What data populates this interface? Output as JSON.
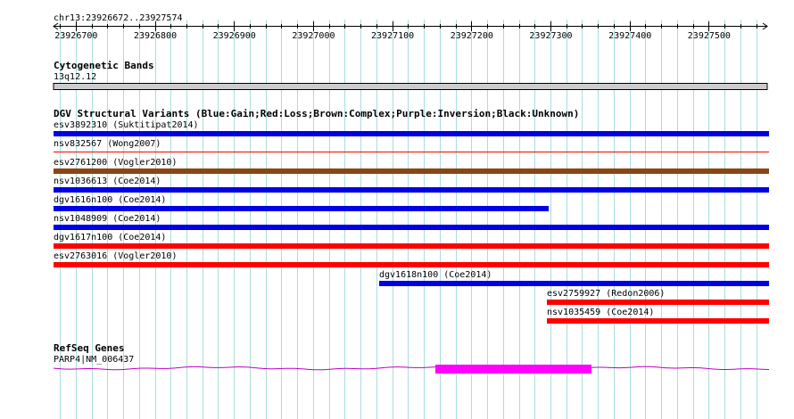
{
  "browser": {
    "ruler": {
      "region_label": "chr13:23926672..23927574",
      "tick_labels": [
        "23926700",
        "23926800",
        "23926900",
        "23927000",
        "23927100",
        "23927200",
        "23927300",
        "23927400",
        "23927500"
      ]
    },
    "cytoband": {
      "title": "Cytogenetic Bands",
      "band_label": "13q12.12"
    },
    "dgv": {
      "title": "DGV Structural Variants (Blue:Gain;Red:Loss;Brown:Complex;Purple:Inversion;Black:Unknown)",
      "features": [
        {
          "label": "esv3892310 (Suktitipat2014)",
          "type": "gain",
          "start": 23926672,
          "end": 23927574
        },
        {
          "label": "nsv832567 (Wong2007)",
          "type": "loss-thin",
          "start": 23926672,
          "end": 23927574
        },
        {
          "label": "esv2761200 (Vogler2010)",
          "type": "complex",
          "start": 23926672,
          "end": 23927574
        },
        {
          "label": "nsv1036613 (Coe2014)",
          "type": "gain",
          "start": 23926672,
          "end": 23927574
        },
        {
          "label": "dgv1616n100 (Coe2014)",
          "type": "gain",
          "start": 23926672,
          "end": 23927295
        },
        {
          "label": "nsv1048909 (Coe2014)",
          "type": "gain",
          "start": 23926672,
          "end": 23927574
        },
        {
          "label": "dgv1617n100 (Coe2014)",
          "type": "loss",
          "start": 23926672,
          "end": 23927574
        },
        {
          "label": "esv2763016 (Vogler2010)",
          "type": "loss",
          "start": 23926672,
          "end": 23927574
        },
        {
          "label": "dgv1618n100 (Coe2014)",
          "type": "gain",
          "start": 23927083,
          "end": 23927574
        },
        {
          "label": "esv2759927 (Redon2006)",
          "type": "loss",
          "start": 23927295,
          "end": 23927574
        },
        {
          "label": "nsv1035459 (Coe2014)",
          "type": "loss",
          "start": 23927295,
          "end": 23927574
        }
      ]
    },
    "refseq": {
      "title": "RefSeq Genes",
      "gene_label": "PARP4|NM_006437",
      "exon_start": 23927155,
      "exon_end": 23927352
    },
    "colors": {
      "gain": "#0000e6",
      "loss": "#ff0000",
      "complex": "#8b4513",
      "gene": "#ff00ff",
      "intron": "#c000c0",
      "grid": "#aadddd",
      "cyto": "#cccccc"
    }
  }
}
